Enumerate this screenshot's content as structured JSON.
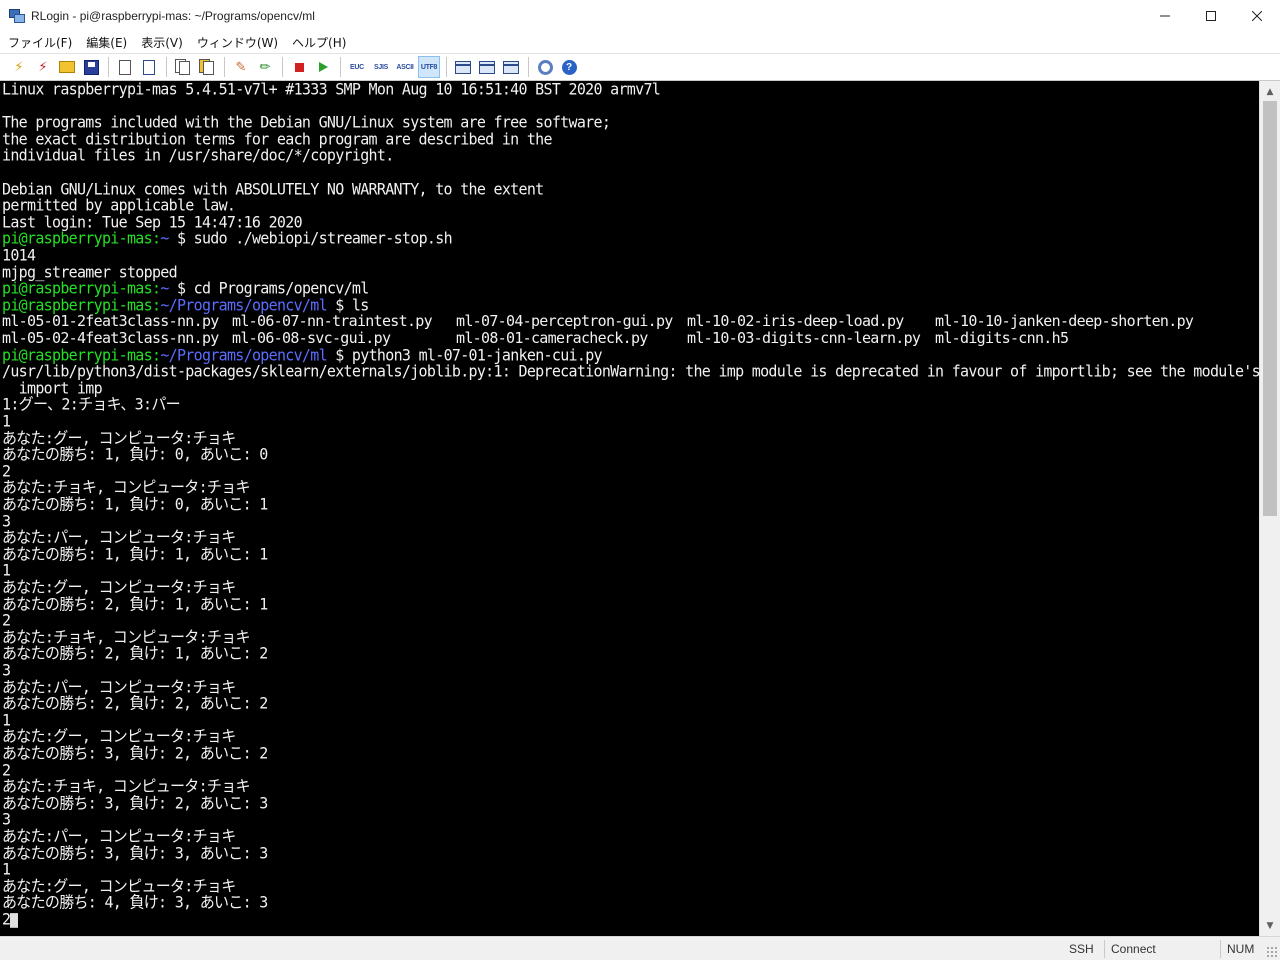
{
  "window": {
    "title": "RLogin - pi@raspberrypi-mas: ~/Programs/opencv/ml",
    "controls": {
      "minimize": "─",
      "maximize": "☐",
      "close": "✕"
    }
  },
  "menu": [
    "ファイル(F)",
    "編集(E)",
    "表示(V)",
    "ウィンドウ(W)",
    "ヘルプ(H)"
  ],
  "toolbar": {
    "euc": "EUC",
    "sjis": "SJIS",
    "ascii": "ASCII",
    "utf8": "UTF8",
    "help": "?"
  },
  "terminal": {
    "lines": [
      {
        "text": "Linux raspberrypi-mas 5.4.51-v7l+ #1333 SMP Mon Aug 10 16:51:40 BST 2020 armv7l"
      },
      {
        "text": ""
      },
      {
        "text": "The programs included with the Debian GNU/Linux system are free software;"
      },
      {
        "text": "the exact distribution terms for each program are described in the"
      },
      {
        "text": "individual files in /usr/share/doc/*/copyright."
      },
      {
        "text": ""
      },
      {
        "text": "Debian GNU/Linux comes with ABSOLUTELY NO WARRANTY, to the extent"
      },
      {
        "text": "permitted by applicable law."
      },
      {
        "text": "Last login: Tue Sep 15 14:47:16 2020"
      },
      {
        "prompt_user": "pi@raspberrypi-mas",
        "prompt_path": "~",
        "text": " $ sudo ./webiopi/streamer-stop.sh"
      },
      {
        "text": "1014"
      },
      {
        "text": "mjpg_streamer stopped"
      },
      {
        "prompt_user": "pi@raspberrypi-mas",
        "prompt_path": "~",
        "text": " $ cd Programs/opencv/ml"
      },
      {
        "prompt_user": "pi@raspberrypi-mas",
        "prompt_path": "~/Programs/opencv/ml",
        "text": " $ ls"
      },
      {
        "ls": [
          "ml-05-01-2feat3class-nn.py",
          "ml-06-07-nn-traintest.py",
          "ml-07-04-perceptron-gui.py",
          "ml-10-02-iris-deep-load.py",
          "ml-10-10-janken-deep-shorten.py"
        ]
      },
      {
        "ls": [
          "ml-05-02-4feat3class-nn.py",
          "ml-06-08-svc-gui.py",
          "ml-08-01-cameracheck.py",
          "ml-10-03-digits-cnn-learn.py",
          "ml-digits-cnn.h5"
        ]
      },
      {
        "prompt_user": "pi@raspberrypi-mas",
        "prompt_path": "~/Programs/opencv/ml",
        "text": " $ python3 ml-07-01-janken-cui.py"
      },
      {
        "text": "/usr/lib/python3/dist-packages/sklearn/externals/joblib.py:1: DeprecationWarning: the imp module is deprecated in favour of importlib; see the module's"
      },
      {
        "text": "  import imp"
      },
      {
        "text": "1:グー、2:チョキ、3:パー"
      },
      {
        "text": "1"
      },
      {
        "text": "あなた:グー, コンピュータ:チョキ"
      },
      {
        "text": "あなたの勝ち: 1, 負け: 0, あいこ: 0"
      },
      {
        "text": "2"
      },
      {
        "text": "あなた:チョキ, コンピュータ:チョキ"
      },
      {
        "text": "あなたの勝ち: 1, 負け: 0, あいこ: 1"
      },
      {
        "text": "3"
      },
      {
        "text": "あなた:パー, コンピュータ:チョキ"
      },
      {
        "text": "あなたの勝ち: 1, 負け: 1, あいこ: 1"
      },
      {
        "text": "1"
      },
      {
        "text": "あなた:グー, コンピュータ:チョキ"
      },
      {
        "text": "あなたの勝ち: 2, 負け: 1, あいこ: 1"
      },
      {
        "text": "2"
      },
      {
        "text": "あなた:チョキ, コンピュータ:チョキ"
      },
      {
        "text": "あなたの勝ち: 2, 負け: 1, あいこ: 2"
      },
      {
        "text": "3"
      },
      {
        "text": "あなた:パー, コンピュータ:チョキ"
      },
      {
        "text": "あなたの勝ち: 2, 負け: 2, あいこ: 2"
      },
      {
        "text": "1"
      },
      {
        "text": "あなた:グー, コンピュータ:チョキ"
      },
      {
        "text": "あなたの勝ち: 3, 負け: 2, あいこ: 2"
      },
      {
        "text": "2"
      },
      {
        "text": "あなた:チョキ, コンピュータ:チョキ"
      },
      {
        "text": "あなたの勝ち: 3, 負け: 2, あいこ: 3"
      },
      {
        "text": "3"
      },
      {
        "text": "あなた:パー, コンピュータ:チョキ"
      },
      {
        "text": "あなたの勝ち: 3, 負け: 3, あいこ: 3"
      },
      {
        "text": "1"
      },
      {
        "text": "あなた:グー, コンピュータ:チョキ"
      },
      {
        "text": "あなたの勝ち: 4, 負け: 3, あいこ: 3"
      },
      {
        "text": "2",
        "cursor": true
      }
    ]
  },
  "status": {
    "protocol": "SSH",
    "state": "Connect",
    "numlock": "NUM"
  },
  "colors": {
    "background": "#000000",
    "foreground": "#f2f2f2",
    "prompt_user": "#24e024",
    "prompt_path": "#5b6cff"
  }
}
